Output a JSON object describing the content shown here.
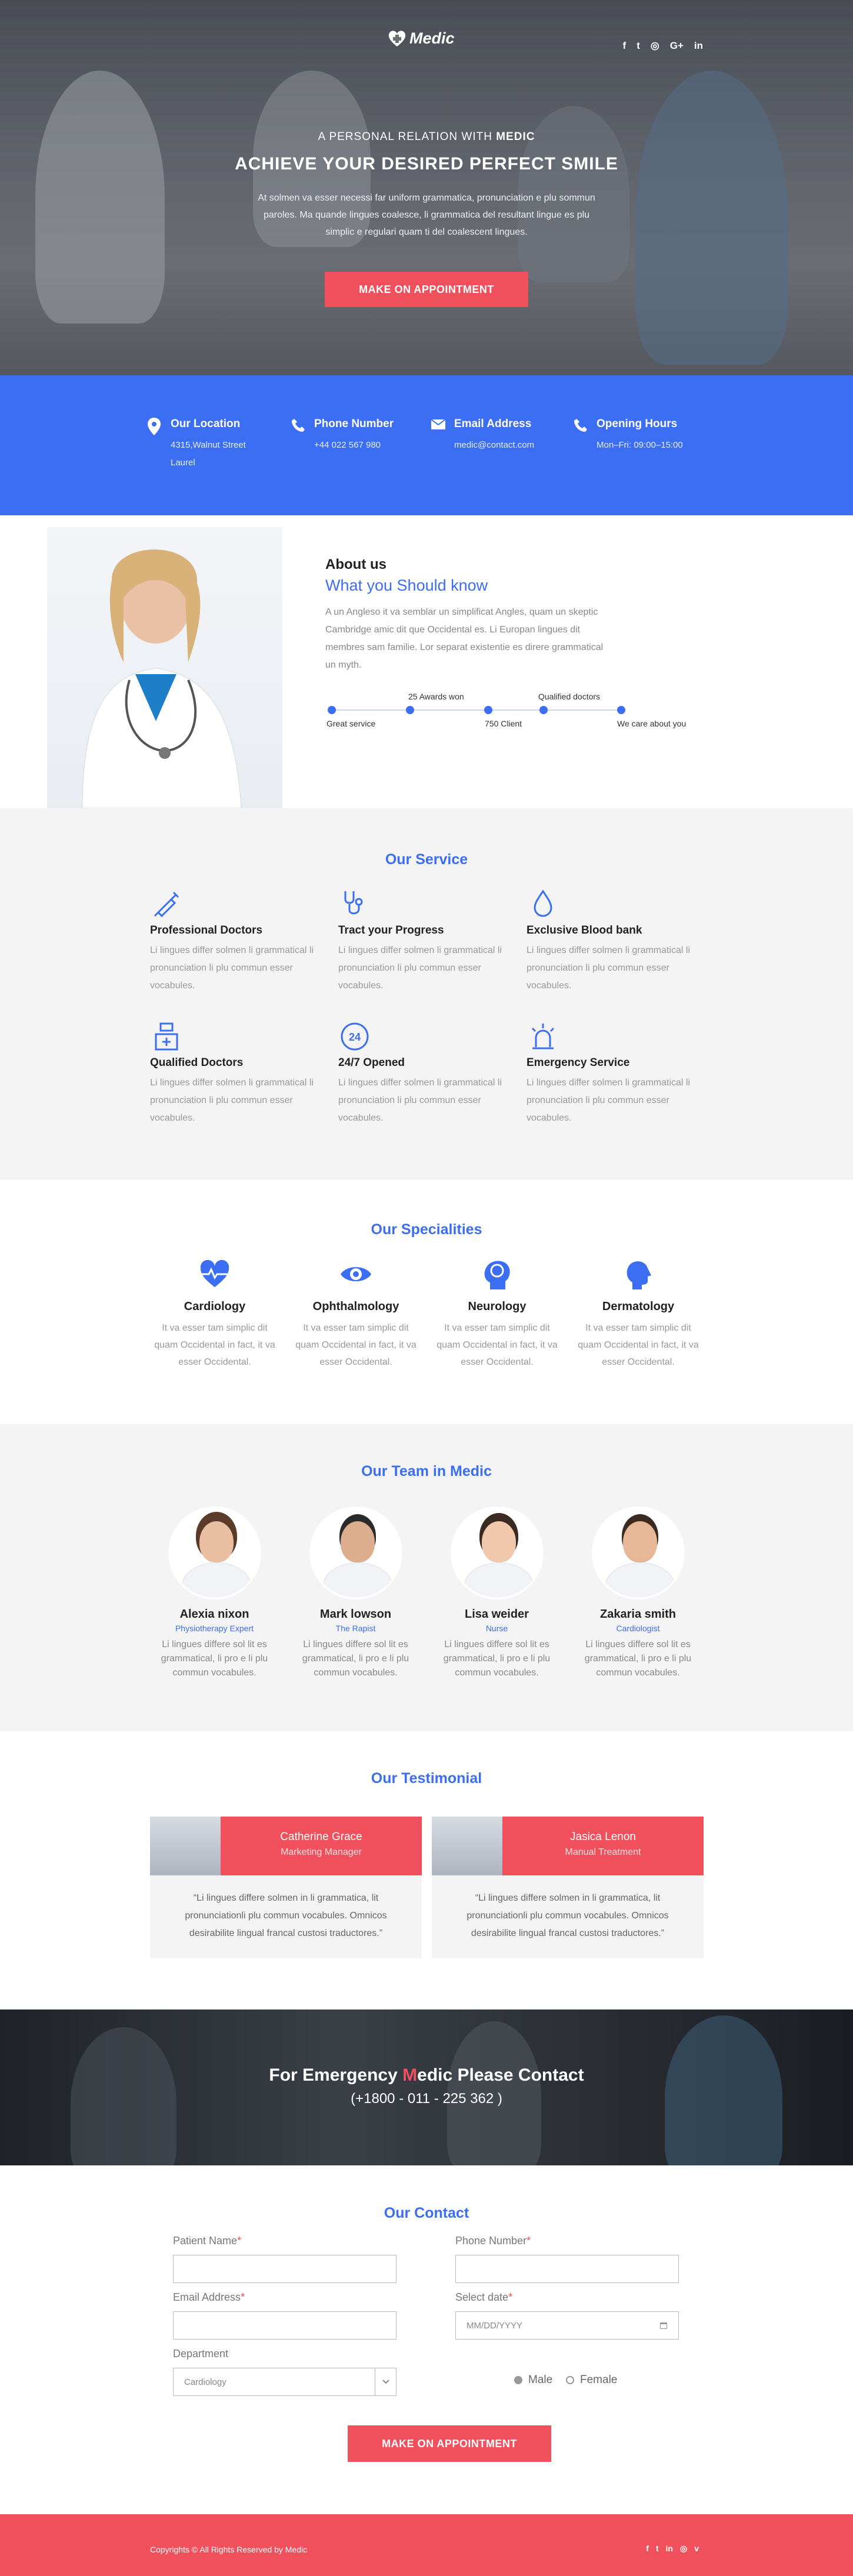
{
  "brand": {
    "name": "Medic",
    "logo_icon": "heart-cross-icon"
  },
  "header": {
    "socials": [
      {
        "icon": "facebook-icon",
        "glyph": "f"
      },
      {
        "icon": "twitter-icon",
        "glyph": "t"
      },
      {
        "icon": "instagram-icon",
        "glyph": "◎"
      },
      {
        "icon": "google-plus-icon",
        "glyph": "G+"
      },
      {
        "icon": "linkedin-icon",
        "glyph": "in"
      }
    ]
  },
  "hero": {
    "subtitle_prefix": "A PERSONAL RELATION WITH ",
    "subtitle_brand": "MEDIC",
    "title": "ACHIEVE YOUR DESIRED PERFECT SMILE",
    "text": "At solmen va esser necessi far uniform grammatica, pronunciation e plu sommun paroles. Ma quande lingues coalesce, li grammatica del resultant lingue es plu simplic e regulari quam ti del coalescent lingues.",
    "cta": "MAKE ON APPOINTMENT"
  },
  "info": [
    {
      "icon": "location-pin-icon",
      "title": "Our Location",
      "lines": [
        "4315,Walnut Street",
        "Laurel"
      ]
    },
    {
      "icon": "phone-icon",
      "title": "Phone Number",
      "lines": [
        "+44 022 567 980"
      ]
    },
    {
      "icon": "envelope-icon",
      "title": "Email Address",
      "lines": [
        "medic@contact.com"
      ]
    },
    {
      "icon": "clock-phone-icon",
      "title": "Opening Hours",
      "lines": [
        "Mon–Fri: 09:00–15:00"
      ]
    }
  ],
  "about": {
    "heading": "About us",
    "subheading": "What you Should know",
    "text": "A un Angleso it va semblar un simplificat Angles, quam un skeptic Cambridge amic dit que Occidental es. Li Europan lingues dit membres sam familie. Lor separat existentie es direre grammatical un myth.",
    "timeline_bottom": [
      "Great service",
      "750 Client",
      "We care about you"
    ],
    "timeline_top": [
      "25 Awards won",
      "Qualified doctors"
    ]
  },
  "services": {
    "title": "Our Service",
    "items": [
      {
        "icon": "syringe-icon",
        "glyph": "✎",
        "title": "Professional Doctors",
        "text": "Li lingues differ solmen li grammatical li pronunciation li plu commun esser vocabules."
      },
      {
        "icon": "stethoscope-icon",
        "glyph": "♁",
        "title": "Tract your Progress",
        "text": "Li lingues differ solmen li grammatical li pronunciation li plu commun esser vocabules."
      },
      {
        "icon": "blood-drop-icon",
        "glyph": "💧",
        "title": "Exclusive Blood bank",
        "text": "Li lingues differ solmen li grammatical li pronunciation li plu commun esser vocabules."
      },
      {
        "icon": "nurse-icon",
        "glyph": "⚕",
        "title": "Qualified Doctors",
        "text": "Li lingues differ solmen li grammatical li pronunciation li plu commun esser vocabules."
      },
      {
        "icon": "24-hours-icon",
        "glyph": "24",
        "title": "24/7 Opened",
        "text": "Li lingues differ solmen li grammatical li pronunciation li plu commun esser vocabules."
      },
      {
        "icon": "siren-icon",
        "glyph": "⚠",
        "title": "Emergency Service",
        "text": "Li lingues differ solmen li grammatical li pronunciation li plu commun esser vocabules."
      }
    ]
  },
  "specialities": {
    "title": "Our Specialities",
    "items": [
      {
        "icon": "heartbeat-icon",
        "glyph": "♥",
        "title": "Cardiology",
        "text": "It va esser tam simplic dit quam Occidental in fact, it va esser Occidental."
      },
      {
        "icon": "eye-icon",
        "glyph": "◉",
        "title": "Ophthalmology",
        "text": "It va esser tam simplic dit quam Occidental in fact, it va esser Occidental."
      },
      {
        "icon": "brain-icon",
        "glyph": "☊",
        "title": "Neurology",
        "text": "It va esser tam simplic dit quam Occidental in fact, it va esser Occidental."
      },
      {
        "icon": "head-profile-icon",
        "glyph": "☻",
        "title": "Dermatology",
        "text": "It va esser tam simplic dit quam Occidental in fact, it va esser Occidental."
      }
    ]
  },
  "team": {
    "title": "Our Team in Medic",
    "members": [
      {
        "name": "Alexia nixon",
        "role": "Physiotherapy Expert",
        "text": "Li lingues differe sol lit es grammatical, li pro e li plu commun vocabules."
      },
      {
        "name": "Mark lowson",
        "role": "The Rapist",
        "text": "Li lingues differe sol lit es grammatical, li pro e li plu commun vocabules."
      },
      {
        "name": "Lisa weider",
        "role": "Nurse",
        "text": "Li lingues differe sol lit es grammatical, li pro e li plu commun vocabules."
      },
      {
        "name": "Zakaria smith",
        "role": "Cardiologist",
        "text": "Li lingues differe sol lit es grammatical, li pro e li plu commun vocabules."
      }
    ]
  },
  "testimonial": {
    "title": "Our Testimonial",
    "items": [
      {
        "name": "Catherine Grace",
        "role": "Marketing Manager",
        "quote": "“Li lingues differe solmen in li grammatica, lit pronunciationli plu commun vocabules. Omnicos desirabilite lingual francal custosi traductores.”"
      },
      {
        "name": "Jasica Lenon",
        "role": "Manual Treatment",
        "quote": "“Li lingues differe solmen in li grammatica, lit pronunciationli plu commun vocabules. Omnicos desirabilite lingual francal custosi traductores.”"
      }
    ]
  },
  "emergency": {
    "title_before": "For Emergency  ",
    "title_accent": "M",
    "title_after": "edic Please Contact",
    "phone": "(+1800 - 011 - 225 362 )"
  },
  "contact": {
    "title": "Our Contact",
    "patient_name_label": "Patient Name",
    "phone_label": "Phone Number",
    "email_label": "Email Address",
    "date_label": "Select date",
    "date_placeholder": "MM/DD/YYYY",
    "department_label": "Department",
    "department_value": "Cardiology",
    "required_mark": "*",
    "gender_options": [
      "Male",
      "Female"
    ],
    "gender_selected": "Male",
    "submit": "MAKE ON APPOINTMENT"
  },
  "footer": {
    "copyright": "Copyrights © All Rights Reserved by Medic",
    "socials": [
      {
        "icon": "facebook-icon",
        "glyph": "f"
      },
      {
        "icon": "twitter-icon",
        "glyph": "t"
      },
      {
        "icon": "linkedin-icon",
        "glyph": "in"
      },
      {
        "icon": "instagram-icon",
        "glyph": "◎"
      },
      {
        "icon": "vimeo-icon",
        "glyph": "v"
      }
    ]
  },
  "colors": {
    "primary": "#3b6ef2",
    "accent": "#f04f5c"
  }
}
